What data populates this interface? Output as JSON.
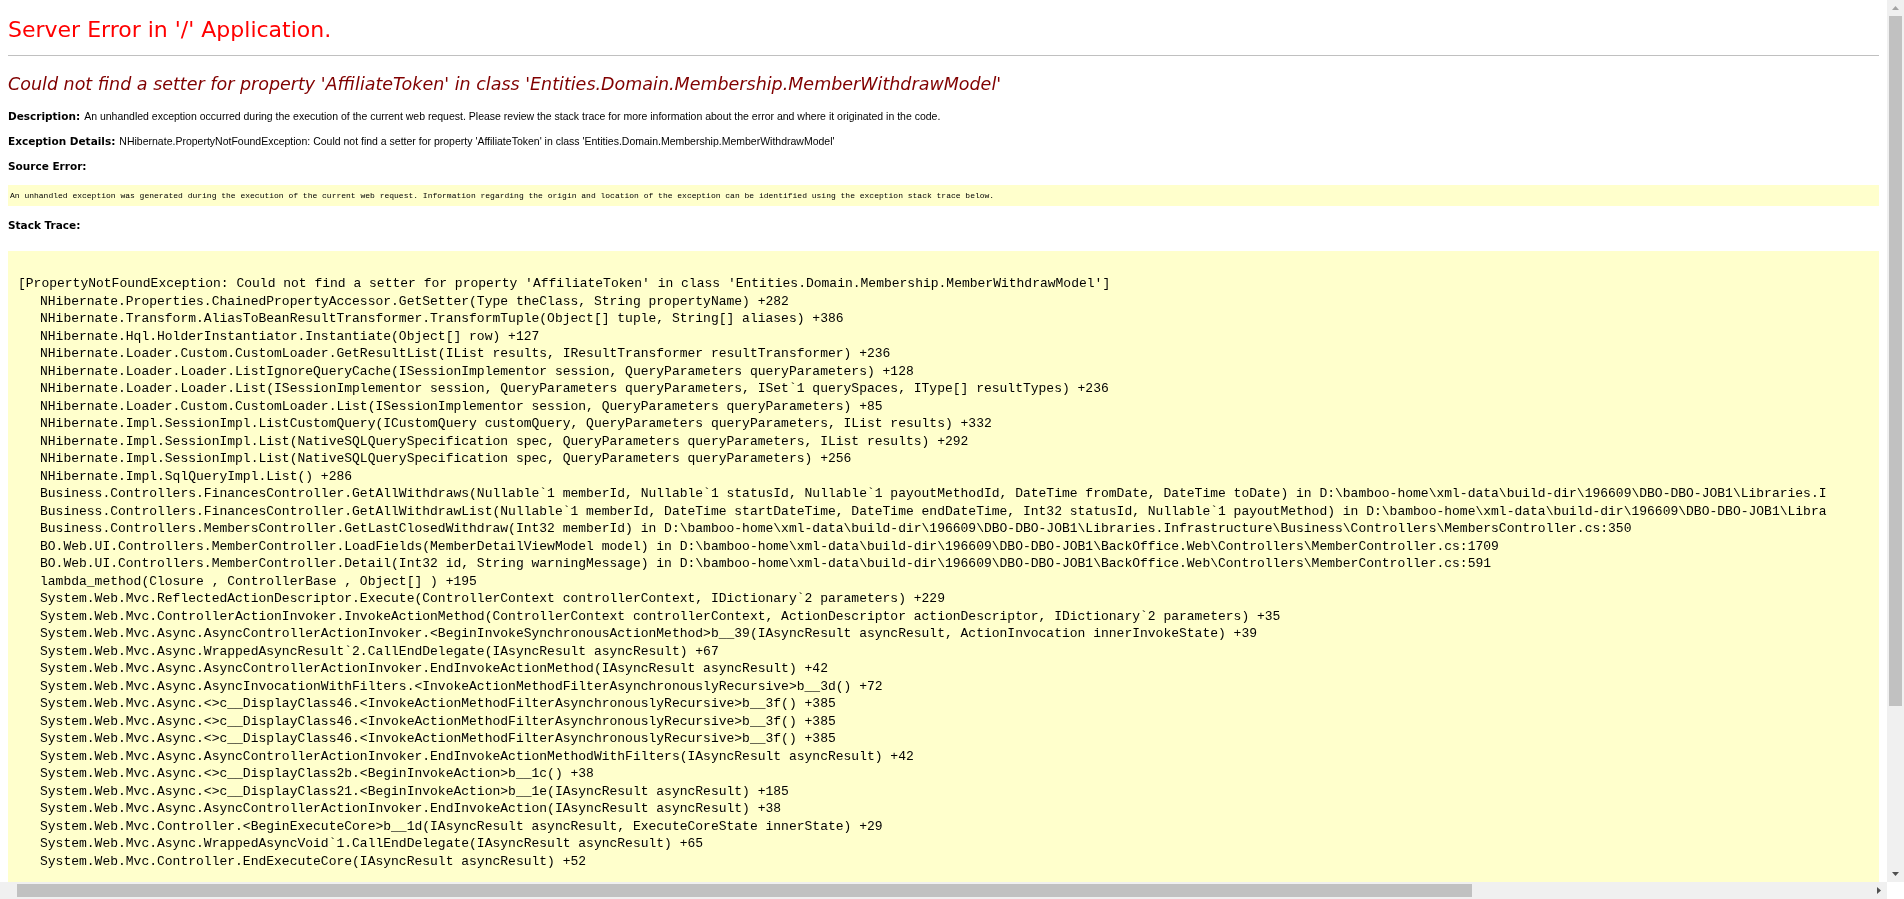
{
  "title": "Server Error in '/' Application.",
  "error_message": "Could not find a setter for property 'AffiliateToken' in class 'Entities.Domain.Membership.MemberWithdrawModel'",
  "description": {
    "label": "Description:",
    "text": "An unhandled exception occurred during the execution of the current web request. Please review the stack trace for more information about the error and where it originated in the code."
  },
  "exception_details": {
    "label": "Exception Details:",
    "text": "NHibernate.PropertyNotFoundException: Could not find a setter for property 'AffiliateToken' in class 'Entities.Domain.Membership.MemberWithdrawModel'"
  },
  "source_error": {
    "label": "Source Error:",
    "text": "An unhandled exception was generated during the execution of the current web request. Information regarding the origin and location of the exception can be identified using the exception stack trace below."
  },
  "stack_trace": {
    "label": "Stack Trace:",
    "header": "[PropertyNotFoundException: Could not find a setter for property 'AffiliateToken' in class 'Entities.Domain.Membership.MemberWithdrawModel']",
    "frames": [
      "NHibernate.Properties.ChainedPropertyAccessor.GetSetter(Type theClass, String propertyName) +282",
      "NHibernate.Transform.AliasToBeanResultTransformer.TransformTuple(Object[] tuple, String[] aliases) +386",
      "NHibernate.Hql.HolderInstantiator.Instantiate(Object[] row) +127",
      "NHibernate.Loader.Custom.CustomLoader.GetResultList(IList results, IResultTransformer resultTransformer) +236",
      "NHibernate.Loader.Loader.ListIgnoreQueryCache(ISessionImplementor session, QueryParameters queryParameters) +128",
      "NHibernate.Loader.Loader.List(ISessionImplementor session, QueryParameters queryParameters, ISet`1 querySpaces, IType[] resultTypes) +236",
      "NHibernate.Loader.Custom.CustomLoader.List(ISessionImplementor session, QueryParameters queryParameters) +85",
      "NHibernate.Impl.SessionImpl.ListCustomQuery(ICustomQuery customQuery, QueryParameters queryParameters, IList results) +332",
      "NHibernate.Impl.SessionImpl.List(NativeSQLQuerySpecification spec, QueryParameters queryParameters, IList results) +292",
      "NHibernate.Impl.SessionImpl.List(NativeSQLQuerySpecification spec, QueryParameters queryParameters) +256",
      "NHibernate.Impl.SqlQueryImpl.List() +286",
      "Business.Controllers.FinancesController.GetAllWithdraws(Nullable`1 memberId, Nullable`1 statusId, Nullable`1 payoutMethodId, DateTime fromDate, DateTime toDate) in D:\\bamboo-home\\xml-data\\build-dir\\196609\\DBO-DBO-JOB1\\Libraries.I",
      "Business.Controllers.FinancesController.GetAllWithdrawList(Nullable`1 memberId, DateTime startDateTime, DateTime endDateTime, Int32 statusId, Nullable`1 payoutMethod) in D:\\bamboo-home\\xml-data\\build-dir\\196609\\DBO-DBO-JOB1\\Libra",
      "Business.Controllers.MembersController.GetLastClosedWithdraw(Int32 memberId) in D:\\bamboo-home\\xml-data\\build-dir\\196609\\DBO-DBO-JOB1\\Libraries.Infrastructure\\Business\\Controllers\\MembersController.cs:350",
      "BO.Web.UI.Controllers.MemberController.LoadFields(MemberDetailViewModel model) in D:\\bamboo-home\\xml-data\\build-dir\\196609\\DBO-DBO-JOB1\\BackOffice.Web\\Controllers\\MemberController.cs:1709",
      "BO.Web.UI.Controllers.MemberController.Detail(Int32 id, String warningMessage) in D:\\bamboo-home\\xml-data\\build-dir\\196609\\DBO-DBO-JOB1\\BackOffice.Web\\Controllers\\MemberController.cs:591",
      "lambda_method(Closure , ControllerBase , Object[] ) +195",
      "System.Web.Mvc.ReflectedActionDescriptor.Execute(ControllerContext controllerContext, IDictionary`2 parameters) +229",
      "System.Web.Mvc.ControllerActionInvoker.InvokeActionMethod(ControllerContext controllerContext, ActionDescriptor actionDescriptor, IDictionary`2 parameters) +35",
      "System.Web.Mvc.Async.AsyncControllerActionInvoker.<BeginInvokeSynchronousActionMethod>b__39(IAsyncResult asyncResult, ActionInvocation innerInvokeState) +39",
      "System.Web.Mvc.Async.WrappedAsyncResult`2.CallEndDelegate(IAsyncResult asyncResult) +67",
      "System.Web.Mvc.Async.AsyncControllerActionInvoker.EndInvokeActionMethod(IAsyncResult asyncResult) +42",
      "System.Web.Mvc.Async.AsyncInvocationWithFilters.<InvokeActionMethodFilterAsynchronouslyRecursive>b__3d() +72",
      "System.Web.Mvc.Async.<>c__DisplayClass46.<InvokeActionMethodFilterAsynchronouslyRecursive>b__3f() +385",
      "System.Web.Mvc.Async.<>c__DisplayClass46.<InvokeActionMethodFilterAsynchronouslyRecursive>b__3f() +385",
      "System.Web.Mvc.Async.<>c__DisplayClass46.<InvokeActionMethodFilterAsynchronouslyRecursive>b__3f() +385",
      "System.Web.Mvc.Async.AsyncControllerActionInvoker.EndInvokeActionMethodWithFilters(IAsyncResult asyncResult) +42",
      "System.Web.Mvc.Async.<>c__DisplayClass2b.<BeginInvokeAction>b__1c() +38",
      "System.Web.Mvc.Async.<>c__DisplayClass21.<BeginInvokeAction>b__1e(IAsyncResult asyncResult) +185",
      "System.Web.Mvc.Async.AsyncControllerActionInvoker.EndInvokeAction(IAsyncResult asyncResult) +38",
      "System.Web.Mvc.Controller.<BeginExecuteCore>b__1d(IAsyncResult asyncResult, ExecuteCoreState innerState) +29",
      "System.Web.Mvc.Async.WrappedAsyncVoid`1.CallEndDelegate(IAsyncResult asyncResult) +65",
      "System.Web.Mvc.Controller.EndExecuteCore(IAsyncResult asyncResult) +52"
    ]
  }
}
